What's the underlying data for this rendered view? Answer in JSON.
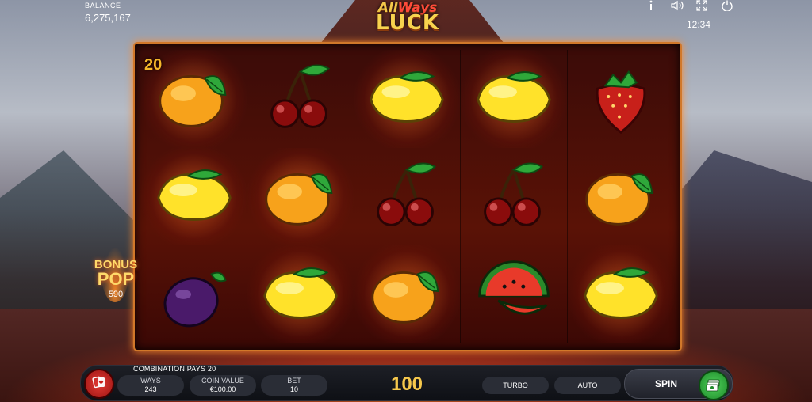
{
  "balance": {
    "label": "BALANCE",
    "value": "6,275,167"
  },
  "logo": {
    "line1_a": "All",
    "line1_b": "Ways",
    "line2": "LUCK"
  },
  "top_icons": [
    "info-icon",
    "sound-icon",
    "fullscreen-icon",
    "power-icon"
  ],
  "clock": "12:34",
  "win_count": "20",
  "reels": {
    "rows": [
      [
        "orange",
        "cherry",
        "lemon",
        "lemon",
        "strawberry"
      ],
      [
        "lemon",
        "orange",
        "cherry",
        "cherry",
        "orange"
      ],
      [
        "plum",
        "lemon",
        "orange",
        "watermelon",
        "lemon"
      ]
    ],
    "highlighted": [
      [
        true,
        false,
        true,
        true,
        false
      ],
      [
        true,
        true,
        false,
        false,
        false
      ],
      [
        false,
        true,
        true,
        false,
        true
      ]
    ]
  },
  "bonus": {
    "line1": "BONUS",
    "line2": "POP",
    "value": "590"
  },
  "combination_text": "COMBINATION PAYS 20",
  "controls": {
    "ways": {
      "label": "WAYS",
      "value": "243"
    },
    "coin_value": {
      "label": "COIN VALUE",
      "value": "€100.00"
    },
    "bet": {
      "label": "BET",
      "value": "10"
    },
    "total": "100",
    "turbo": "TURBO",
    "auto": "AUTO",
    "spin": "SPIN"
  },
  "colors": {
    "accent": "#f6c84c",
    "frame": "#d1782a",
    "spin_green": "#2fb83c",
    "menu_red": "#d6302b"
  }
}
